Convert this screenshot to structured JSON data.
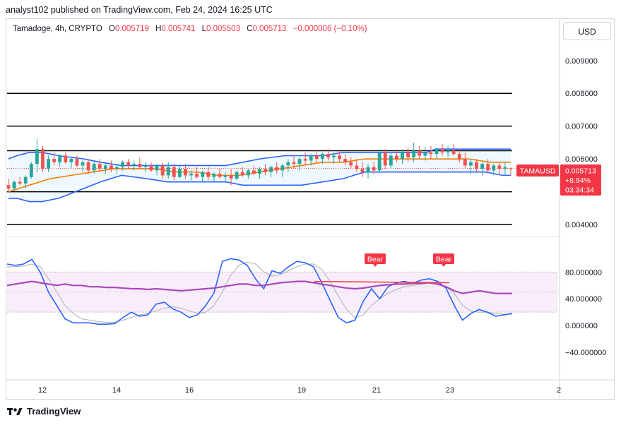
{
  "header": {
    "published": "analyst102 published on TradingView.com, Feb 24, 2024 16:25 UTC"
  },
  "symbol": {
    "name": "Tamadoge, 4h, CRYPTO",
    "open_label": "O",
    "open": "0.005719",
    "high_label": "H",
    "high": "0.005741",
    "low_label": "L",
    "low": "0.005503",
    "close_label": "C",
    "close": "0.005713",
    "change": "−0.000006 (−0.10%)"
  },
  "currency_button": "USD",
  "price_tag": {
    "ticker": "TAMAUSD",
    "price": "0.005713",
    "change": "+8.94%",
    "countdown": "03:34:34"
  },
  "footer": {
    "brand": "TradingView"
  },
  "colors": {
    "up": "#26a69a",
    "down": "#ef5350",
    "bollinger": "#2962ff",
    "ma": "#f57c00",
    "rsi": "#ab47bc",
    "stoch_k": "#2962ff",
    "stoch_d": "#b2b5be",
    "level": "#000000",
    "bear": "#f23645"
  },
  "chart_data": [
    {
      "type": "candlestick",
      "title": "Tamadoge, 4h, CRYPTO",
      "x_ticks": [
        "12",
        "14",
        "16",
        "19",
        "21",
        "23",
        "2"
      ],
      "y_ticks": [
        "0.009000",
        "0.008000",
        "0.007000",
        "0.006000",
        "0.005000",
        "0.004000"
      ],
      "ylim": [
        0.0037,
        0.0102
      ],
      "horizontal_levels": [
        0.008,
        0.007,
        0.00625,
        0.005,
        0.004
      ],
      "last_price": 0.005713,
      "indicators": [
        "Bollinger Bands",
        "Moving Average"
      ],
      "bollinger": {
        "x": [
          0,
          2,
          5,
          8,
          12,
          18,
          22,
          27,
          33,
          38,
          45,
          52,
          56,
          60,
          66,
          70,
          75,
          80,
          85,
          88,
          92,
          96,
          100,
          102,
          106,
          110,
          114,
          118,
          120
        ],
        "upper": [
          0.006,
          0.0061,
          0.0062,
          0.0062,
          0.0061,
          0.006,
          0.0059,
          0.0058,
          0.0058,
          0.0058,
          0.0058,
          0.0058,
          0.0059,
          0.006,
          0.0061,
          0.0061,
          0.0061,
          0.0062,
          0.0062,
          0.0062,
          0.0062,
          0.0062,
          0.0062,
          0.0063,
          0.0063,
          0.0063,
          0.0063,
          0.0063,
          0.0063
        ],
        "middle": [
          0.005,
          0.0052,
          0.0054,
          0.0055,
          0.0056,
          0.0056,
          0.0056,
          0.0056,
          0.0055,
          0.0055,
          0.0055,
          0.0055,
          0.0056,
          0.0057,
          0.0058,
          0.0059,
          0.0059,
          0.006,
          0.006,
          0.006,
          0.006,
          0.006,
          0.006,
          0.006,
          0.006,
          0.006,
          0.0059,
          0.0059,
          0.0059
        ],
        "lower": [
          0.0048,
          0.0048,
          0.0047,
          0.0047,
          0.0048,
          0.0051,
          0.0053,
          0.0055,
          0.0054,
          0.0053,
          0.0053,
          0.0053,
          0.0052,
          0.0052,
          0.0052,
          0.0052,
          0.0053,
          0.0054,
          0.0056,
          0.0056,
          0.0056,
          0.0056,
          0.0056,
          0.0056,
          0.0056,
          0.0056,
          0.0056,
          0.0055,
          0.0055
        ]
      },
      "moving_average": {
        "x": [
          0,
          5,
          10,
          15,
          20,
          25,
          30,
          35,
          40,
          45,
          50,
          55,
          60,
          65,
          70,
          75,
          80,
          85,
          90,
          95,
          100,
          105,
          110,
          115,
          120
        ],
        "values": [
          0.005,
          0.0052,
          0.0054,
          0.0055,
          0.0056,
          0.0057,
          0.0057,
          0.0057,
          0.0056,
          0.0056,
          0.0055,
          0.0055,
          0.0056,
          0.0057,
          0.0058,
          0.0059,
          0.0059,
          0.006,
          0.006,
          0.006,
          0.006,
          0.006,
          0.006,
          0.0059,
          0.0059
        ]
      },
      "candles": [
        [
          0.0052,
          0.0054,
          0.005,
          0.0051
        ],
        [
          0.0051,
          0.00535,
          0.00505,
          0.0053
        ],
        [
          0.0053,
          0.00545,
          0.0052,
          0.00525
        ],
        [
          0.00525,
          0.0055,
          0.0051,
          0.00545
        ],
        [
          0.00545,
          0.0059,
          0.0054,
          0.00585
        ],
        [
          0.00585,
          0.0066,
          0.0056,
          0.0063
        ],
        [
          0.0063,
          0.0064,
          0.0056,
          0.0057
        ],
        [
          0.0057,
          0.0061,
          0.0056,
          0.006
        ],
        [
          0.006,
          0.0062,
          0.0058,
          0.0059
        ],
        [
          0.0059,
          0.00615,
          0.00575,
          0.0061
        ],
        [
          0.0061,
          0.0062,
          0.00585,
          0.0059
        ],
        [
          0.0059,
          0.00605,
          0.0057,
          0.006
        ],
        [
          0.006,
          0.0061,
          0.00575,
          0.0058
        ],
        [
          0.0058,
          0.00595,
          0.0056,
          0.0059
        ],
        [
          0.0059,
          0.006,
          0.00555,
          0.00565
        ],
        [
          0.00565,
          0.0059,
          0.00555,
          0.00585
        ],
        [
          0.00585,
          0.006,
          0.0056,
          0.0057
        ],
        [
          0.0057,
          0.0059,
          0.00555,
          0.0058
        ],
        [
          0.0058,
          0.00595,
          0.0056,
          0.0057
        ],
        [
          0.0057,
          0.00585,
          0.00555,
          0.00575
        ],
        [
          0.00575,
          0.00595,
          0.00565,
          0.0059
        ],
        [
          0.0059,
          0.006,
          0.0057,
          0.0058
        ],
        [
          0.0058,
          0.00595,
          0.00565,
          0.00585
        ],
        [
          0.00585,
          0.00605,
          0.0057,
          0.00575
        ],
        [
          0.00575,
          0.0059,
          0.0056,
          0.0058
        ],
        [
          0.0058,
          0.0059,
          0.0056,
          0.00565
        ],
        [
          0.00565,
          0.00585,
          0.0055,
          0.0058
        ],
        [
          0.0058,
          0.0059,
          0.0054,
          0.0055
        ],
        [
          0.0055,
          0.0059,
          0.0054,
          0.00575
        ],
        [
          0.00575,
          0.00585,
          0.00535,
          0.00545
        ],
        [
          0.00545,
          0.0058,
          0.0054,
          0.0057
        ],
        [
          0.0057,
          0.00585,
          0.0054,
          0.0055
        ],
        [
          0.0055,
          0.00565,
          0.00535,
          0.00555
        ],
        [
          0.00555,
          0.00575,
          0.0054,
          0.00545
        ],
        [
          0.00545,
          0.00565,
          0.0053,
          0.0056
        ],
        [
          0.0056,
          0.00575,
          0.00535,
          0.00545
        ],
        [
          0.00545,
          0.0056,
          0.0053,
          0.00555
        ],
        [
          0.00555,
          0.0057,
          0.0054,
          0.00545
        ],
        [
          0.00545,
          0.0056,
          0.0053,
          0.0055
        ],
        [
          0.0055,
          0.0057,
          0.0052,
          0.0054
        ],
        [
          0.0054,
          0.00565,
          0.00535,
          0.0056
        ],
        [
          0.0056,
          0.00575,
          0.00545,
          0.0055
        ],
        [
          0.0055,
          0.0057,
          0.0054,
          0.00565
        ],
        [
          0.00565,
          0.0058,
          0.0055,
          0.00555
        ],
        [
          0.00555,
          0.00575,
          0.0054,
          0.0057
        ],
        [
          0.0057,
          0.00585,
          0.0055,
          0.0056
        ],
        [
          0.0056,
          0.0058,
          0.00545,
          0.00575
        ],
        [
          0.00575,
          0.0059,
          0.00555,
          0.00565
        ],
        [
          0.00565,
          0.00585,
          0.00545,
          0.0058
        ],
        [
          0.0058,
          0.006,
          0.0056,
          0.0059
        ],
        [
          0.0059,
          0.0061,
          0.0057,
          0.00585
        ],
        [
          0.00585,
          0.00605,
          0.00565,
          0.006
        ],
        [
          0.006,
          0.0062,
          0.0058,
          0.00595
        ],
        [
          0.00595,
          0.00615,
          0.0058,
          0.0061
        ],
        [
          0.0061,
          0.00625,
          0.0059,
          0.006
        ],
        [
          0.006,
          0.0062,
          0.00585,
          0.00615
        ],
        [
          0.00615,
          0.0063,
          0.00595,
          0.00605
        ],
        [
          0.00605,
          0.0062,
          0.00585,
          0.0061
        ],
        [
          0.0061,
          0.00625,
          0.0059,
          0.006
        ],
        [
          0.006,
          0.00615,
          0.0058,
          0.0059
        ],
        [
          0.0059,
          0.00605,
          0.0057,
          0.0058
        ],
        [
          0.0058,
          0.006,
          0.0056,
          0.0057
        ],
        [
          0.0057,
          0.0059,
          0.00545,
          0.0056
        ],
        [
          0.0056,
          0.00585,
          0.0054,
          0.00575
        ],
        [
          0.00575,
          0.0059,
          0.00555,
          0.00565
        ],
        [
          0.00565,
          0.0063,
          0.0056,
          0.0062
        ],
        [
          0.0062,
          0.0063,
          0.0057,
          0.0058
        ],
        [
          0.0058,
          0.0062,
          0.0057,
          0.0061
        ],
        [
          0.0061,
          0.00625,
          0.0059,
          0.006
        ],
        [
          0.006,
          0.0063,
          0.00585,
          0.0062
        ],
        [
          0.0062,
          0.00635,
          0.0059,
          0.00605
        ],
        [
          0.00605,
          0.0065,
          0.0059,
          0.00625
        ],
        [
          0.00625,
          0.0064,
          0.006,
          0.0061
        ],
        [
          0.0061,
          0.00635,
          0.00595,
          0.0062
        ],
        [
          0.0062,
          0.0064,
          0.006,
          0.00615
        ],
        [
          0.00615,
          0.00635,
          0.006,
          0.0063
        ],
        [
          0.0063,
          0.00645,
          0.0061,
          0.0062
        ],
        [
          0.0062,
          0.0064,
          0.00605,
          0.00625
        ],
        [
          0.00625,
          0.00645,
          0.0061,
          0.00615
        ],
        [
          0.00615,
          0.0063,
          0.0059,
          0.006
        ],
        [
          0.006,
          0.0062,
          0.0057,
          0.0058
        ],
        [
          0.0058,
          0.006,
          0.00555,
          0.0059
        ],
        [
          0.0059,
          0.006,
          0.0056,
          0.0057
        ],
        [
          0.0057,
          0.0059,
          0.0055,
          0.00585
        ],
        [
          0.00585,
          0.006,
          0.0056,
          0.00565
        ],
        [
          0.00565,
          0.00585,
          0.0055,
          0.0058
        ],
        [
          0.0058,
          0.0059,
          0.00555,
          0.0057
        ],
        [
          0.0057,
          0.0059,
          0.0055,
          0.00575
        ],
        [
          0.005719,
          0.005741,
          0.005503,
          0.005713
        ]
      ]
    },
    {
      "type": "line",
      "title": "Stochastic RSI oscillator",
      "y_ticks": [
        "80.000000",
        "40.000000",
        "0.000000",
        "−40.000000"
      ],
      "ylim": [
        -78,
        130
      ],
      "band": [
        20,
        80
      ],
      "dotted_levels": [
        20,
        50,
        80
      ],
      "x_ticks": [
        "12",
        "14",
        "16",
        "19",
        "21",
        "23",
        "2"
      ],
      "annotations": [
        "Bear",
        "Bear"
      ],
      "divergence_line": {
        "from": 66,
        "to": 64
      },
      "series": [
        {
          "values": [
            92,
            90,
            92,
            99,
            80,
            50,
            30,
            10,
            4,
            4,
            4,
            2,
            2,
            3,
            12,
            20,
            14,
            16,
            32,
            35,
            25,
            20,
            12,
            16,
            30,
            49,
            96,
            100,
            98,
            90,
            70,
            55,
            82,
            78,
            88,
            96,
            94,
            88,
            64,
            38,
            12,
            4,
            8,
            36,
            55,
            40,
            58,
            64,
            66,
            63,
            68,
            70,
            66,
            56,
            30,
            8,
            18,
            24,
            20,
            14,
            16,
            18
          ]
        },
        {
          "values": [
            88,
            88,
            89,
            92,
            88,
            70,
            50,
            30,
            18,
            10,
            8,
            6,
            5,
            5,
            8,
            12,
            16,
            18,
            22,
            26,
            28,
            26,
            22,
            18,
            20,
            30,
            50,
            75,
            90,
            95,
            92,
            80,
            74,
            76,
            82,
            88,
            92,
            92,
            84,
            66,
            44,
            24,
            12,
            16,
            30,
            40,
            48,
            54,
            58,
            60,
            62,
            64,
            64,
            58,
            48,
            30,
            22,
            20,
            20,
            18,
            17,
            17
          ]
        },
        {
          "values": [
            60,
            62,
            64,
            66,
            64,
            62,
            60,
            62,
            60,
            60,
            58,
            58,
            57,
            57,
            56,
            55,
            55,
            54,
            55,
            54,
            53,
            52,
            53,
            54,
            55,
            56,
            58,
            60,
            62,
            62,
            60,
            60,
            62,
            64,
            65,
            66,
            66,
            64,
            62,
            60,
            58,
            56,
            55,
            56,
            58,
            60,
            61,
            62,
            62,
            63,
            63,
            64,
            62,
            58,
            52,
            48,
            50,
            52,
            50,
            48,
            48,
            48
          ]
        }
      ]
    }
  ]
}
